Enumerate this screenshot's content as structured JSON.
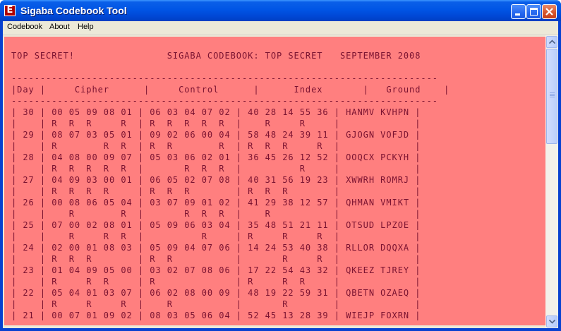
{
  "window": {
    "title": "Sigaba Codebook Tool",
    "app_icon_glyph": "E",
    "app_icon": "sigaba-app-icon",
    "controls": [
      "minimize-icon",
      "maximize-icon",
      "close-icon"
    ]
  },
  "menu": {
    "items": [
      "Codebook",
      "About",
      "Help"
    ]
  },
  "codebook": {
    "lines": [
      "",
      "TOP SECRET!                SIGABA CODEBOOK: TOP SECRET   SEPTEMBER 2008",
      "",
      "--------------------------------------------------------------------------",
      "|Day |     Cipher      |     Control      |      Index       |   Ground    |",
      "--------------------------------------------------------------------------",
      "| 30 | 00 05 09 08 01 | 06 03 04 07 02 | 40 28 14 55 36 | HANMV KVHPN |",
      "|    | R  R  R     R  | R  R  R  R  R  |    R     R     |             |",
      "| 29 | 08 07 03 05 01 | 09 02 06 00 04 | 58 48 24 39 11 | GJOGN VOFJD |",
      "|    | R        R  R  | R  R        R  | R  R  R     R  |             |",
      "| 28 | 04 08 00 09 07 | 05 03 06 02 01 | 36 45 26 12 52 | OOQCX PCKYH |",
      "|    | R  R  R  R  R  |       R  R  R  |          R     |             |",
      "| 27 | 04 09 03 00 01 | 06 05 02 07 08 | 40 31 56 19 23 | XWWRH ROMRJ |",
      "|    | R  R  R  R     | R  R  R        | R  R  R        |             |",
      "| 26 | 00 08 06 05 04 | 03 07 09 01 02 | 41 29 38 12 57 | QHMAN VMIKT |",
      "|    |    R        R  |       R  R  R  |    R           |             |",
      "| 25 | 07 00 02 08 01 | 05 09 06 03 04 | 35 48 51 21 11 | OTSUD LPZOE |",
      "|    |    R     R  R  |          R     | R     R     R  |             |",
      "| 24 | 02 00 01 08 03 | 05 09 04 07 06 | 14 24 53 40 38 | RLLOR DQQXA |",
      "|    | R  R  R        | R  R           |       R     R  |             |",
      "| 23 | 01 04 09 05 00 | 03 02 07 08 06 | 17 22 54 43 32 | QKEEZ TJREY |",
      "|    | R     R  R     | R              | R     R  R     |             |",
      "| 22 | 05 04 01 03 07 | 06 02 08 00 09 | 48 19 22 59 31 | QBETN OZAEQ |",
      "|    | R     R     R  |    R           |       R        |             |",
      "| 21 | 00 07 01 09 02 | 08 03 05 06 04 | 52 45 13 28 39 | WIEJP FOXRN |"
    ]
  },
  "colors": {
    "text_background": "#ff7f7f",
    "text_color": "#7a1230",
    "titlebar": "#0055e5"
  }
}
